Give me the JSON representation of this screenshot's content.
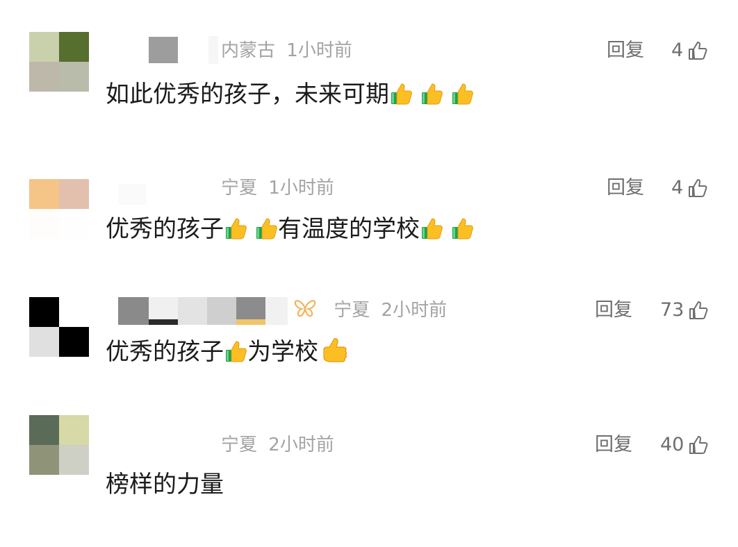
{
  "comments": [
    {
      "location": "内蒙古",
      "time": "1小时前",
      "text": "如此优秀的孩子，未来可期",
      "emoji_count": 3,
      "reply_label": "回复",
      "likes": "4",
      "avatar_colors": [
        "#c9d1ac",
        "#566e2e",
        "#bdb8a9",
        "#b9bcaa"
      ]
    },
    {
      "location": "宁夏",
      "time": "1小时前",
      "text_before": "优秀的孩子",
      "text_after": "有温度的学校",
      "reply_label": "回复",
      "likes": "4",
      "avatar_colors": [
        "#f4c586",
        "#e2c0ad",
        "#ffffff",
        "#ffffff"
      ]
    },
    {
      "location": "宁夏",
      "time": "2小时前",
      "text_before": "优秀的孩子",
      "text_after": "为学校",
      "reply_label": "回复",
      "likes": "73",
      "avatar_colors": [
        "#000000",
        "#ffffff",
        "#e0e0e0",
        "#000000"
      ]
    },
    {
      "location": "宁夏",
      "time": "2小时前",
      "text": "榜样的力量",
      "reply_label": "回复",
      "likes": "40",
      "avatar_colors": [
        "#5a6b58",
        "#d7d9a6",
        "#8f9479",
        "#cfd0c5"
      ]
    }
  ]
}
